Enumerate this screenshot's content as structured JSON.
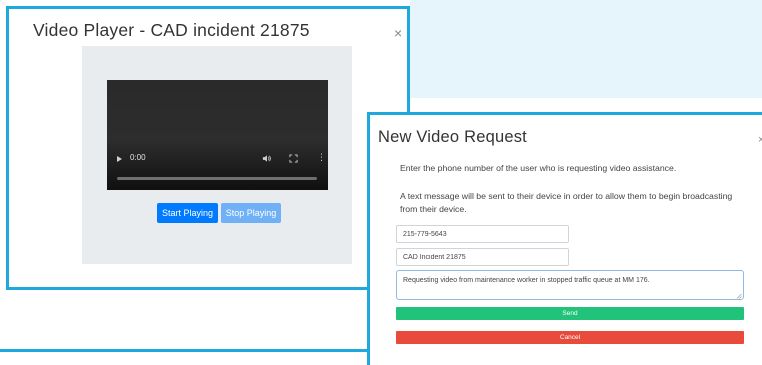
{
  "colors": {
    "accent_border": "#1fa8db",
    "primary_button": "#007bff",
    "secondary_button": "#6fb0f7",
    "send_button": "#21c27a",
    "cancel_button": "#e84b3c"
  },
  "video_player_modal": {
    "title": "Video Player - CAD incident 21875",
    "close_icon": "×",
    "video": {
      "current_time": "0:00",
      "progress": 0,
      "controls_icons": [
        "play-icon",
        "volume-icon",
        "fullscreen-icon",
        "more-options-icon"
      ],
      "more_glyph": "⋮"
    },
    "start_button": "Start Playing",
    "stop_button": "Stop Playing"
  },
  "video_request_modal": {
    "title": "New Video Request",
    "close_icon": "×",
    "instruction_1": "Enter the phone number of the user who is requesting video assistance.",
    "instruction_2": "A text message will be sent to their device in order to allow them to begin broadcasting from their device.",
    "phone_value": "215-779-5643",
    "cad_value": "CAD Incident 21875",
    "message_value": "Requesting video from maintenance worker in stopped traffic queue at MM 176.",
    "send_button": "Send",
    "cancel_button": "Cancel"
  }
}
